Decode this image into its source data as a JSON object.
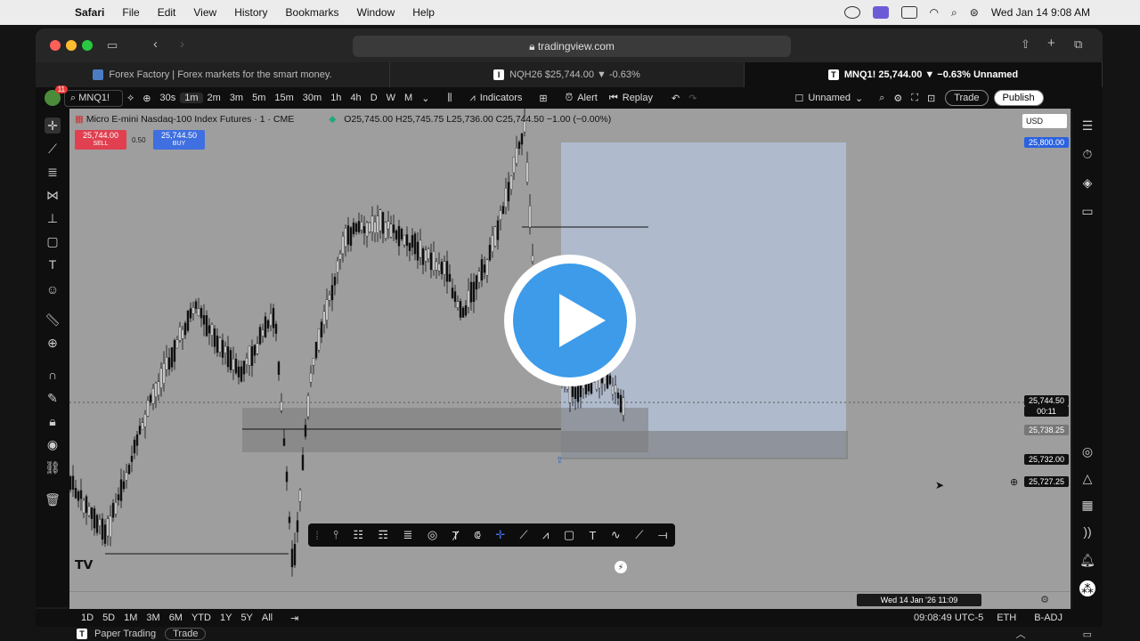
{
  "menubar": {
    "app": "Safari",
    "items": [
      "File",
      "Edit",
      "View",
      "History",
      "Bookmarks",
      "Window",
      "Help"
    ],
    "clock": "Wed Jan 14  9:08 AM"
  },
  "browser": {
    "url": "tradingview.com",
    "tabs": [
      {
        "label": "Forex Factory | Forex markets for the smart money."
      },
      {
        "label": "NQH26 $25,744.00 ▼ -0.63%"
      },
      {
        "label": "MNQ1! 25,744.00 ▼ −0.63% Unnamed"
      }
    ]
  },
  "tv_toolbar": {
    "notif_count": "11",
    "symbol": "MNQ1!",
    "intervals": [
      "30s",
      "1m",
      "2m",
      "3m",
      "5m",
      "15m",
      "30m",
      "1h",
      "4h",
      "D",
      "W",
      "M"
    ],
    "active_interval": "1m",
    "indicators": "Indicators",
    "alert": "Alert",
    "replay": "Replay",
    "layout_name": "Unnamed",
    "trade": "Trade",
    "publish": "Publish"
  },
  "chart": {
    "title": "Micro E-mini Nasdaq-100 Index Futures · 1 · CME",
    "ohlc": "O25,745.00 H25,745.75 L25,736.00 C25,744.50 −1.00 (−0.00%)",
    "sell_price": "25,744.00",
    "sell_label": "SELL",
    "spread": "0.50",
    "buy_price": "25,744.50",
    "buy_label": "BUY",
    "currency": "USD",
    "price_labels": [
      "25,800.00",
      "25,744.50",
      "00:11",
      "25,738.25",
      "25,732.00",
      "25,727.25"
    ],
    "crosshair_time": "Wed 14 Jan '26   11:09"
  },
  "bottom": {
    "ranges": [
      "1D",
      "5D",
      "1M",
      "3M",
      "6M",
      "YTD",
      "1Y",
      "5Y",
      "All"
    ],
    "clock": "09:08:49 UTC-5",
    "session": "ETH",
    "adj": "B-ADJ"
  },
  "footer": {
    "paper": "Paper Trading",
    "trade": "Trade"
  },
  "colors": {
    "sell": "#e04050",
    "buy": "#3f6fe0",
    "play": "#3d9be9"
  }
}
